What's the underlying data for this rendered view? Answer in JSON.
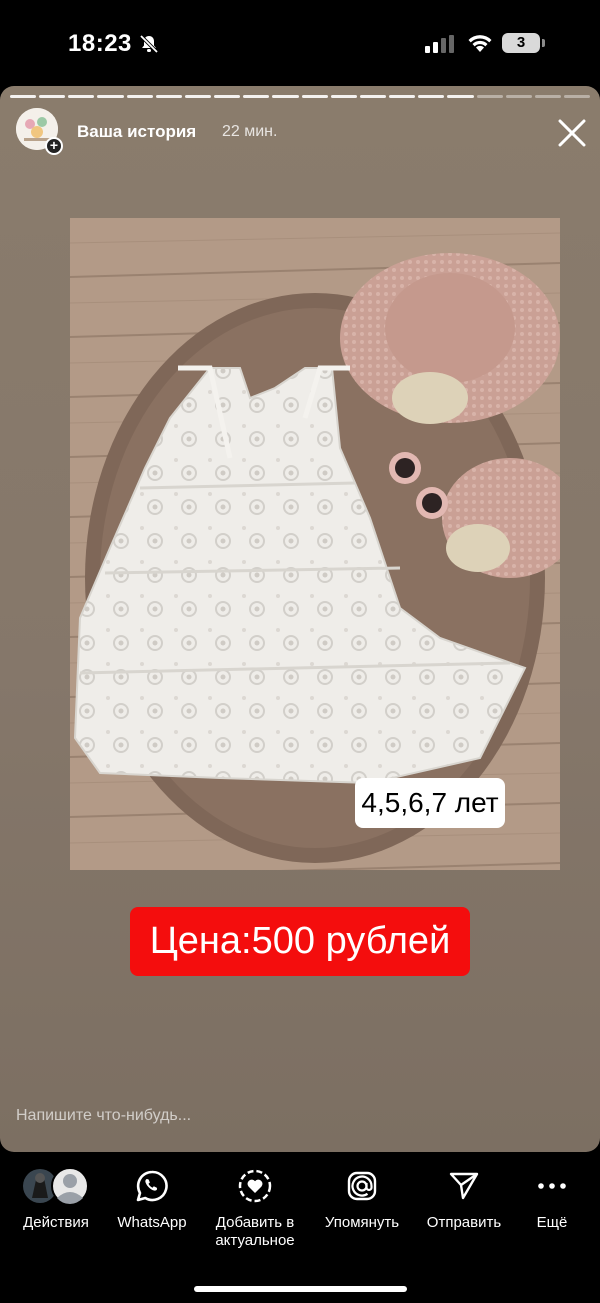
{
  "status_bar": {
    "time": "18:23",
    "battery": "3",
    "icons": [
      "bell-muted-icon",
      "cellular-signal-icon",
      "wifi-icon",
      "battery-icon"
    ]
  },
  "story": {
    "user": "Ваша история",
    "time_ago": "22 мин.",
    "progress": {
      "segments": 20,
      "viewed": 16
    },
    "size_tag": "4,5,6,7 лет",
    "price": "Цена:500 рублей",
    "reply_placeholder": "Напишите что-нибудь..."
  },
  "actions": [
    {
      "label": "Действия",
      "icon": "avatars-icon"
    },
    {
      "label": "WhatsApp",
      "icon": "whatsapp-icon"
    },
    {
      "label": "Добавить в актуальное",
      "icon": "highlight-heart-icon"
    },
    {
      "label": "Упомянуть",
      "icon": "mention-icon"
    },
    {
      "label": "Отправить",
      "icon": "send-icon"
    },
    {
      "label": "Ещё",
      "icon": "more-icon"
    }
  ],
  "colors": {
    "price_bg": "#f40d0d",
    "story_bg": "#85776a"
  }
}
